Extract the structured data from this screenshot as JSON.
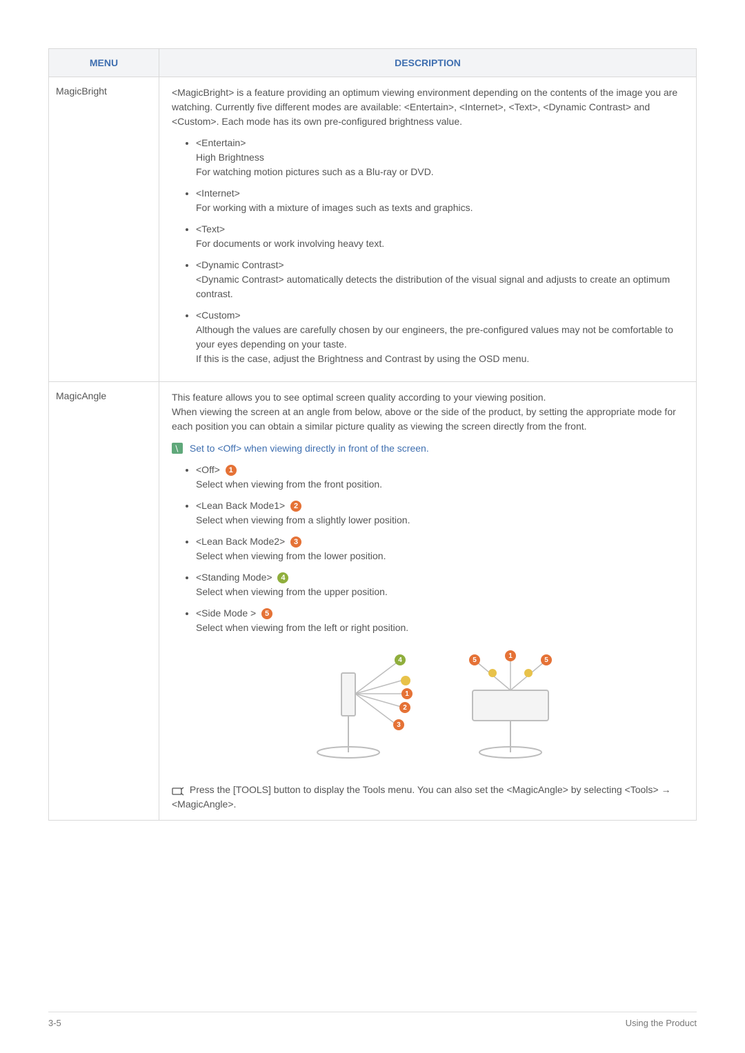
{
  "header": {
    "menu": "MENU",
    "description": "DESCRIPTION"
  },
  "rows": {
    "magicbright": {
      "name": "MagicBright",
      "intro": "<MagicBright> is a feature providing an optimum viewing environment depending on the contents of the image you are watching. Currently five different modes are available: <Entertain>, <Internet>, <Text>, <Dynamic Contrast> and <Custom>. Each mode has its own pre-configured brightness value.",
      "items": [
        {
          "title": "<Entertain>",
          "line2": "High Brightness",
          "line3": "For watching motion pictures such as a Blu-ray or DVD."
        },
        {
          "title": "<Internet>",
          "line2": "For working with a mixture of images such as texts and graphics."
        },
        {
          "title": "<Text>",
          "line2": "For documents or work involving heavy text."
        },
        {
          "title": "<Dynamic Contrast>",
          "line2": "<Dynamic Contrast> automatically detects the distribution of the visual signal and adjusts to create an optimum contrast."
        },
        {
          "title": "<Custom>",
          "line2": "Although the values are carefully chosen by our engineers, the pre-configured values may not be comfortable to your eyes depending on your taste.",
          "line3": "If this is the case, adjust the Brightness and Contrast by using the OSD menu."
        }
      ]
    },
    "magicangle": {
      "name": "MagicAngle",
      "intro": "This feature allows you to see optimal screen quality according to your viewing position.\nWhen viewing the screen at an angle from below, above or the side of the product, by setting the appropriate mode for each position you can obtain a similar picture quality as viewing the screen directly from the front.",
      "note": "Set to <Off> when viewing directly in front of the screen.",
      "items": [
        {
          "title": "<Off>",
          "badge": "1",
          "desc": "Select when viewing from the front position."
        },
        {
          "title": "<Lean Back Mode1>",
          "badge": "2",
          "desc": "Select when viewing from a slightly lower position."
        },
        {
          "title": "<Lean Back Mode2>",
          "badge": "3",
          "desc": "Select when viewing from the lower position."
        },
        {
          "title": "<Standing Mode>",
          "badge": "4",
          "desc": "Select when viewing from the upper position."
        },
        {
          "title": "<Side Mode >",
          "badge": "5",
          "desc": "Select when viewing from the left or right position."
        }
      ],
      "footer_note": "Press the [TOOLS] button to display the Tools menu. You can also set the <MagicAngle> by selecting <Tools> → <MagicAngle>."
    }
  },
  "footer": {
    "page": "3-5",
    "section": "Using the Product"
  }
}
